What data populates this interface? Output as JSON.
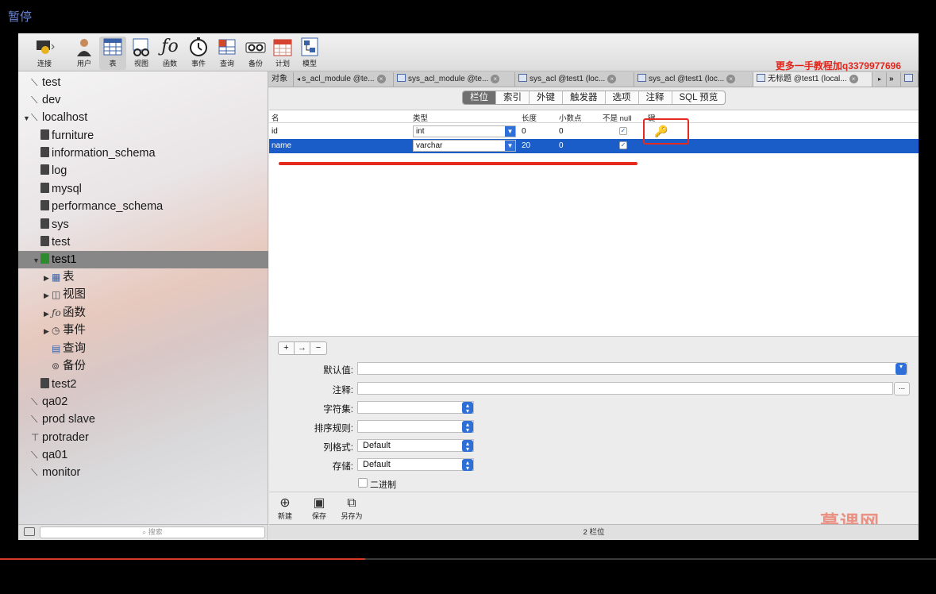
{
  "overlay": {
    "pause_label": "暂停",
    "watermark": "更多一手教程加q3379977696",
    "progress": 0.39,
    "brand": "慕课网"
  },
  "toolbar": {
    "items": [
      {
        "label": "连接",
        "icon": "connection-icon"
      },
      {
        "label": "用户",
        "icon": "user-icon"
      },
      {
        "label": "表",
        "icon": "table-icon"
      },
      {
        "label": "视图",
        "icon": "view-icon"
      },
      {
        "label": "函数",
        "icon": "function-icon"
      },
      {
        "label": "事件",
        "icon": "event-icon"
      },
      {
        "label": "查询",
        "icon": "query-icon"
      },
      {
        "label": "备份",
        "icon": "backup-icon"
      },
      {
        "label": "计划",
        "icon": "schedule-icon"
      },
      {
        "label": "模型",
        "icon": "model-icon"
      }
    ]
  },
  "sidebar": {
    "items": [
      {
        "label": "test"
      },
      {
        "label": "dev"
      },
      {
        "label": "localhost"
      },
      {
        "label": "furniture"
      },
      {
        "label": "information_schema"
      },
      {
        "label": "log"
      },
      {
        "label": "mysql"
      },
      {
        "label": "performance_schema"
      },
      {
        "label": "sys"
      },
      {
        "label": "test"
      },
      {
        "label": "test1"
      },
      {
        "label": "表"
      },
      {
        "label": "视图"
      },
      {
        "label": "函数"
      },
      {
        "label": "事件"
      },
      {
        "label": "查询"
      },
      {
        "label": "备份"
      },
      {
        "label": "test2"
      },
      {
        "label": "qa02"
      },
      {
        "label": "prod slave"
      },
      {
        "label": "protrader"
      },
      {
        "label": "qa01"
      },
      {
        "label": "monitor"
      }
    ],
    "search_placeholder": "搜索",
    "fo_glyph": "ƒo"
  },
  "tabs": {
    "objects": "对象",
    "items": [
      {
        "label": "s_acl_module @te..."
      },
      {
        "label": "sys_acl_module @te..."
      },
      {
        "label": "sys_acl @test1 (loc..."
      },
      {
        "label": "sys_acl @test1 (loc..."
      },
      {
        "label": "无标题 @test1 (local..."
      }
    ]
  },
  "segments": [
    "栏位",
    "索引",
    "外键",
    "触发器",
    "选项",
    "注释",
    "SQL 预览"
  ],
  "grid": {
    "headers": [
      "名",
      "类型",
      "长度",
      "小数点",
      "不是 null",
      "键"
    ],
    "rows": [
      {
        "name": "id",
        "type": "int",
        "length": "0",
        "decimals": "0",
        "not_null": true,
        "key": true
      },
      {
        "name": "name",
        "type": "varchar",
        "length": "20",
        "decimals": "0",
        "not_null": true,
        "key": false
      }
    ]
  },
  "form": {
    "default_label": "默认值:",
    "comment_label": "注释:",
    "charset_label": "字符集:",
    "collation_label": "排序规则:",
    "column_format_label": "列格式:",
    "column_format_value": "Default",
    "storage_label": "存储:",
    "storage_value": "Default",
    "binary_label": "二进制",
    "dots": "..."
  },
  "actions": {
    "new": "新建",
    "save": "保存",
    "save_as": "另存为"
  },
  "status": "2 栏位"
}
